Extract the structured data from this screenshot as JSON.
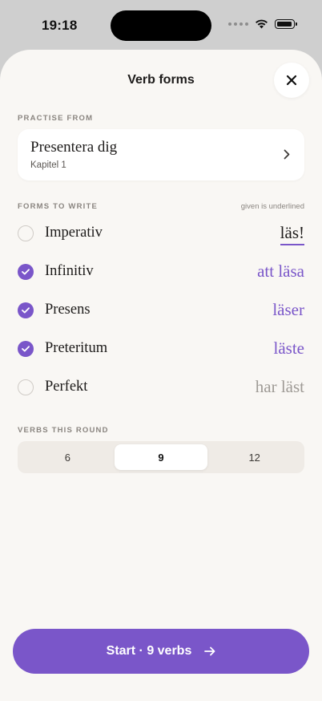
{
  "status_bar": {
    "time": "19:18"
  },
  "header": {
    "title": "Verb forms",
    "close_icon": "close-icon"
  },
  "practise_from": {
    "label": "PRACTISE FROM",
    "title": "Presentera dig",
    "subtitle": "Kapitel 1"
  },
  "forms": {
    "label": "FORMS TO WRITE",
    "hint": "given is underlined",
    "items": [
      {
        "name": "Imperativ",
        "value": "läs!",
        "selected": false,
        "given": true
      },
      {
        "name": "Infinitiv",
        "value": "att läsa",
        "selected": true,
        "given": false
      },
      {
        "name": "Presens",
        "value": "läser",
        "selected": true,
        "given": false
      },
      {
        "name": "Preteritum",
        "value": "läste",
        "selected": true,
        "given": false
      },
      {
        "name": "Perfekt",
        "value": "har läst",
        "selected": false,
        "given": false
      }
    ]
  },
  "verbs_round": {
    "label": "VERBS THIS ROUND",
    "options": [
      "6",
      "9",
      "12"
    ],
    "selected": "9"
  },
  "start_button": {
    "label": "Start · 9 verbs",
    "icon": "arrow-right-icon"
  },
  "colors": {
    "accent": "#7a56c9",
    "background": "#f9f7f4"
  }
}
